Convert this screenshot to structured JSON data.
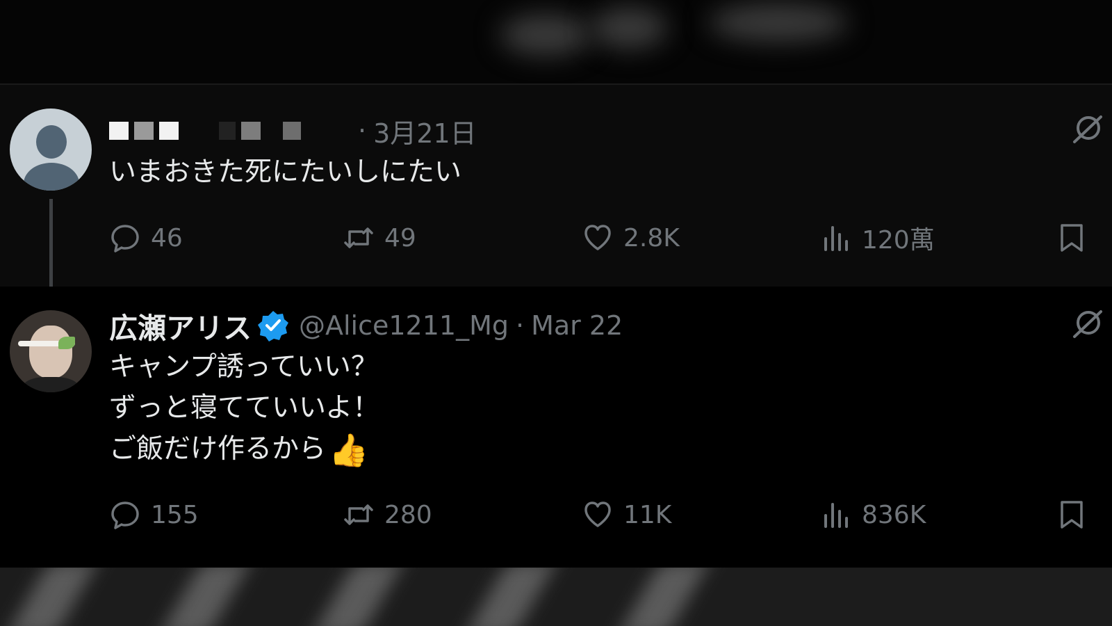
{
  "parent_tweet": {
    "date": "3月21日",
    "separator": "·",
    "text": "いまおきた死にたいしにたい",
    "stats": {
      "replies": "46",
      "retweets": "49",
      "likes": "2.8K",
      "views": "120萬"
    }
  },
  "reply_tweet": {
    "display_name": "広瀬アリス",
    "handle": "@Alice1211_Mg",
    "separator": "·",
    "date": "Mar 22",
    "text_lines": [
      "キャンプ誘っていい？",
      "ずっと寝てていいよ！",
      "ご飯だけ作るから"
    ],
    "emoji": "👍",
    "stats": {
      "replies": "155",
      "retweets": "280",
      "likes": "11K",
      "views": "836K"
    }
  },
  "icons": [
    "reply-icon",
    "retweet-icon",
    "like-icon",
    "views-icon",
    "bookmark-icon",
    "verified-badge-icon",
    "grok-icon"
  ],
  "colors": {
    "background": "#000000",
    "text_primary": "#e7e9ea",
    "text_secondary": "#71767b",
    "verified_blue": "#1d9bf0"
  }
}
